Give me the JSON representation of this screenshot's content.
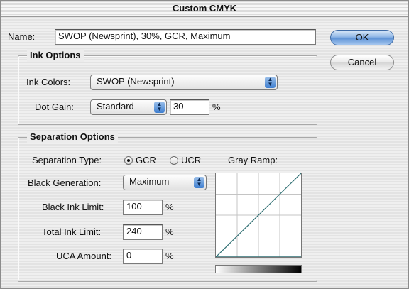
{
  "window": {
    "title": "Custom CMYK"
  },
  "name_field": {
    "label": "Name:",
    "value": "SWOP (Newsprint), 30%, GCR, Maximum"
  },
  "buttons": {
    "ok": "OK",
    "cancel": "Cancel"
  },
  "ink_options": {
    "title": "Ink Options",
    "ink_colors_label": "Ink Colors:",
    "ink_colors_value": "SWOP (Newsprint)",
    "dot_gain_label": "Dot Gain:",
    "dot_gain_mode": "Standard",
    "dot_gain_value": "30",
    "dot_gain_unit": "%"
  },
  "separation_options": {
    "title": "Separation Options",
    "type_label": "Separation Type:",
    "type_options": [
      "GCR",
      "UCR"
    ],
    "type_selected": "GCR",
    "black_generation_label": "Black Generation:",
    "black_generation_value": "Maximum",
    "black_ink_limit_label": "Black Ink Limit:",
    "black_ink_limit_value": "100",
    "total_ink_limit_label": "Total Ink Limit:",
    "total_ink_limit_value": "240",
    "uca_amount_label": "UCA Amount:",
    "uca_amount_value": "0",
    "percent_unit": "%",
    "gray_ramp_label": "Gray Ramp:"
  },
  "colors": {
    "curve": "#2f6f73",
    "accent_button": "#6f9fdc"
  }
}
